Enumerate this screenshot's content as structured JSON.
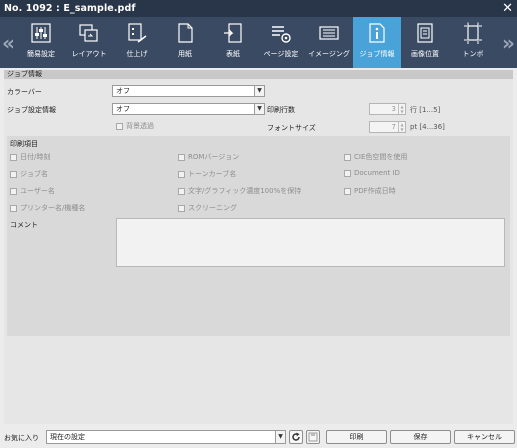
{
  "window": {
    "title": "No. 1092 :  E_sample.pdf"
  },
  "toolbar": {
    "tabs": [
      {
        "label": "簡易設定",
        "icon": "sliders-icon"
      },
      {
        "label": "レイアウト",
        "icon": "layout-icon"
      },
      {
        "label": "仕上げ",
        "icon": "finishing-icon"
      },
      {
        "label": "用紙",
        "icon": "paper-icon"
      },
      {
        "label": "表紙",
        "icon": "cover-icon"
      },
      {
        "label": "ページ設定",
        "icon": "page-settings-icon"
      },
      {
        "label": "イメージング",
        "icon": "imaging-icon"
      },
      {
        "label": "ジョブ情報",
        "icon": "job-info-icon"
      },
      {
        "label": "画像位置",
        "icon": "image-position-icon"
      },
      {
        "label": "トンボ",
        "icon": "crop-marks-icon"
      }
    ],
    "active_index": 7
  },
  "job_info": {
    "section_title": "ジョブ情報",
    "color_bar_label": "カラーバー",
    "color_bar_value": "オフ",
    "job_setting_label": "ジョブ設定情報",
    "job_setting_value": "オフ",
    "background_transparency_label": "背景透過",
    "print_lines_label": "印刷行数",
    "print_lines_value": "3",
    "print_lines_range": "行 [1...5]",
    "font_size_label": "フォントサイズ",
    "font_size_value": "7",
    "font_size_range": "pt [4...36]"
  },
  "print_items": {
    "section_title": "印刷項目",
    "items": [
      "日付/時刻",
      "ROMバージョン",
      "CIE色空間を使用",
      "ジョブ名",
      "トーンカーブ名",
      "Document ID",
      "ユーザー名",
      "文字/グラフィック濃度100%を保持",
      "PDF作成日時",
      "プリンター名/機種名",
      "スクリーニング"
    ],
    "comment_label": "コメント"
  },
  "footer": {
    "favorites_label": "お気に入り",
    "favorites_value": "現在の設定",
    "print_label": "印刷",
    "save_label": "保存",
    "cancel_label": "キャンセル"
  },
  "colors": {
    "titlebar": "#293548",
    "toolbar": "#3a4a63",
    "active_tab": "#4aa3d8"
  }
}
